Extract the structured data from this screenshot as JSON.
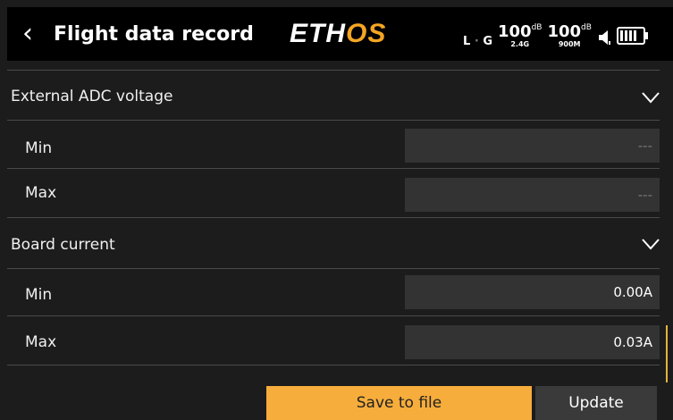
{
  "header": {
    "back_icon": "chevron-left-icon",
    "title": "Flight data record",
    "logo_main": "ETH",
    "logo_accent": "OS",
    "status": {
      "telemetry_left": "L",
      "telemetry_right": "G",
      "signal1_value": "100",
      "signal1_unit": "dB",
      "signal1_band": "2.4G",
      "signal2_value": "100",
      "signal2_unit": "dB",
      "signal2_band": "900M"
    }
  },
  "sections": [
    {
      "title": "External ADC voltage",
      "rows": [
        {
          "label": "Min",
          "value": "---"
        },
        {
          "label": "Max",
          "value": "---"
        }
      ]
    },
    {
      "title": "Board current",
      "rows": [
        {
          "label": "Min",
          "value": "0.00A"
        },
        {
          "label": "Max",
          "value": "0.03A"
        }
      ]
    }
  ],
  "buttons": {
    "save": "Save to file",
    "update": "Update"
  },
  "colors": {
    "accent": "#f7ad3b",
    "background": "#1c1c1c",
    "header": "#000000",
    "field": "#333333"
  }
}
